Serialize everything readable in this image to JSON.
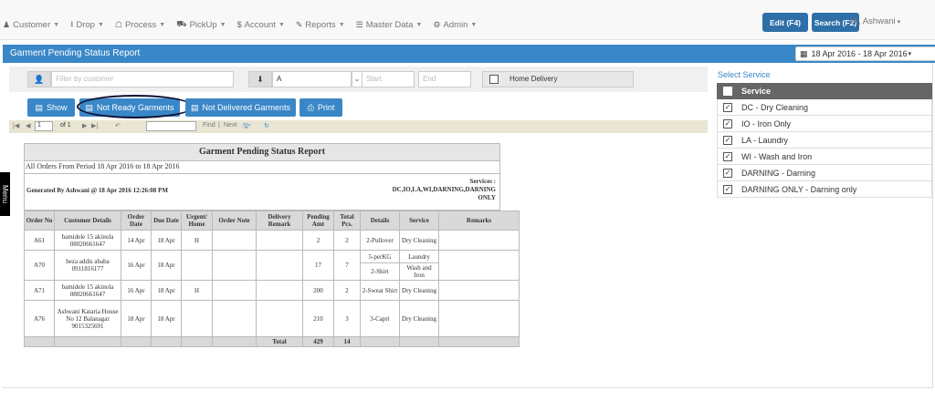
{
  "nav": {
    "items": [
      {
        "icon": "♟",
        "icon_name": "users-icon",
        "label": "Customer"
      },
      {
        "icon": "⭳",
        "icon_name": "download-icon",
        "label": "Drop"
      },
      {
        "icon": "☖",
        "icon_name": "trophy-icon",
        "label": "Process"
      },
      {
        "icon": "⛟",
        "icon_name": "truck-icon",
        "label": "PickUp"
      },
      {
        "icon": "$",
        "icon_name": "dollar-icon",
        "label": "Account"
      },
      {
        "icon": "✎",
        "icon_name": "chart-icon",
        "label": "Reports"
      },
      {
        "icon": "☰",
        "icon_name": "list-icon",
        "label": "Master Data"
      },
      {
        "icon": "⚙",
        "icon_name": "gear-icon",
        "label": "Admin"
      }
    ],
    "edit_label": "Edit (F4)",
    "search_label": "Search (F2)",
    "user_label": "Hi, Ashwani"
  },
  "header": {
    "title": "Garment Pending Status Report",
    "date_range": "18 Apr 2016 - 18 Apr 2016"
  },
  "filters": {
    "customer_placeholder": "Filter by customer",
    "route_value": "A",
    "start_placeholder": "Start",
    "end_placeholder": "End",
    "home_delivery_label": "Home Delivery"
  },
  "actions": {
    "show_label": "Show",
    "not_ready_label": "Not Ready Garments",
    "not_delivered_label": "Not Delivered Garments",
    "print_label": "Print"
  },
  "toolbar": {
    "page_value": "1",
    "page_of": "of 1",
    "find_label": "Find",
    "next_label": "Next"
  },
  "menu_tab": "Menu",
  "report": {
    "title": "Garment Pending Status Report",
    "subtitle": "All Orders   From Period 18 Apr 2016 to 18 Apr 2016",
    "generated_by": "Generated By Ashwani @ 18 Apr 2016 12:26:08 PM",
    "services_label": "Services :",
    "services_value": "DC,IO,LA,WI,DARNING,DARNING",
    "services_value2": "ONLY",
    "headers": [
      "Order No",
      "Customer Details",
      "Order Date",
      "Due Date",
      "Urgent/ Home",
      "Order Note",
      "Delivery Remark",
      "Pending Amt",
      "Total Pcs.",
      "Details",
      "Service",
      "Remarks"
    ],
    "rows": [
      {
        "order": "A61",
        "customer": "bamidele 15 akinola 08020661647",
        "order_date": "14 Apr",
        "due_date": "18 Apr",
        "urgent": "H",
        "pending": "2",
        "total": "2",
        "lines": [
          {
            "detail": "2-Pullover",
            "service": "Dry Cleaning"
          }
        ]
      },
      {
        "order": "A70",
        "customer": "beza addis ababa 0911816177",
        "order_date": "16 Apr",
        "due_date": "18 Apr",
        "urgent": "",
        "pending": "17",
        "total": "7",
        "lines": [
          {
            "detail": "5-perKG",
            "service": "Laundry"
          },
          {
            "detail": "2-Shirt",
            "service": "Wash and Iron"
          }
        ]
      },
      {
        "order": "A71",
        "customer": "bamidele 15 akinola 08020661647",
        "order_date": "16 Apr",
        "due_date": "18 Apr",
        "urgent": "H",
        "pending": "200",
        "total": "2",
        "lines": [
          {
            "detail": "2-Sweat Shirt",
            "service": "Dry Cleaning"
          }
        ]
      },
      {
        "order": "A76",
        "customer": "Ashwani Kataria House No 12 Balanagar 9015325691",
        "order_date": "18 Apr",
        "due_date": "18 Apr",
        "urgent": "",
        "pending": "210",
        "total": "3",
        "lines": [
          {
            "detail": "3-Capri",
            "service": "Dry Cleaning"
          }
        ]
      }
    ],
    "total_label": "Total",
    "total_pending": "429",
    "total_pcs": "14"
  },
  "services": {
    "title": "Select Service",
    "header": "Service",
    "items": [
      {
        "label": "DC -  Dry Cleaning",
        "checked": true
      },
      {
        "label": "IO -  Iron Only",
        "checked": true
      },
      {
        "label": "LA -  Laundry",
        "checked": true
      },
      {
        "label": "WI -  Wash and Iron",
        "checked": true
      },
      {
        "label": "DARNING -  Darning",
        "checked": true
      },
      {
        "label": "DARNING ONLY -  Darning only",
        "checked": true
      }
    ]
  },
  "colors": {
    "accent": "#3a87c8",
    "nav_bg": "#f8f8f8",
    "button_dark": "#2f6fa8",
    "highlight_ellipse": "#0d1030"
  }
}
